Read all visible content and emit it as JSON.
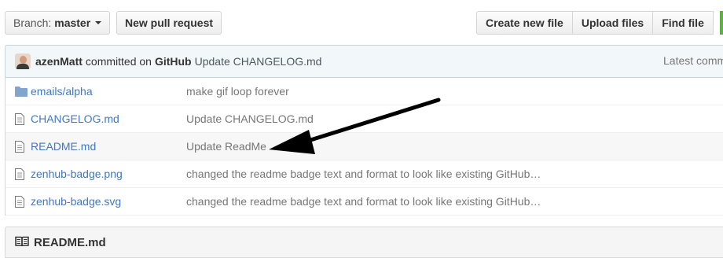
{
  "toolbar": {
    "branch_prefix": "Branch:",
    "branch_name": "master",
    "new_pull_request": "New pull request",
    "create_new_file": "Create new file",
    "upload_files": "Upload files",
    "find_file": "Find file"
  },
  "commit": {
    "author": "azenMatt",
    "committed_on": "committed on",
    "platform": "GitHub",
    "message": "Update CHANGELOG.md",
    "latest": "Latest comm"
  },
  "files": [
    {
      "type": "folder",
      "name": "emails/alpha",
      "message": "make gif loop forever"
    },
    {
      "type": "file",
      "name": "CHANGELOG.md",
      "message": "Update CHANGELOG.md"
    },
    {
      "type": "file",
      "name": "README.md",
      "message": "Update ReadMe"
    },
    {
      "type": "file",
      "name": "zenhub-badge.png",
      "message": "changed the readme badge text and format to look like existing GitHub…"
    },
    {
      "type": "file",
      "name": "zenhub-badge.svg",
      "message": "changed the readme badge text and format to look like existing GitHub…"
    }
  ],
  "readme": {
    "title": "README.md",
    "icon": "book-icon"
  },
  "colors": {
    "link": "#4078c0",
    "muted": "#767676",
    "commit_bg": "#f2f8fa",
    "annotation_arrow": "#000000"
  }
}
